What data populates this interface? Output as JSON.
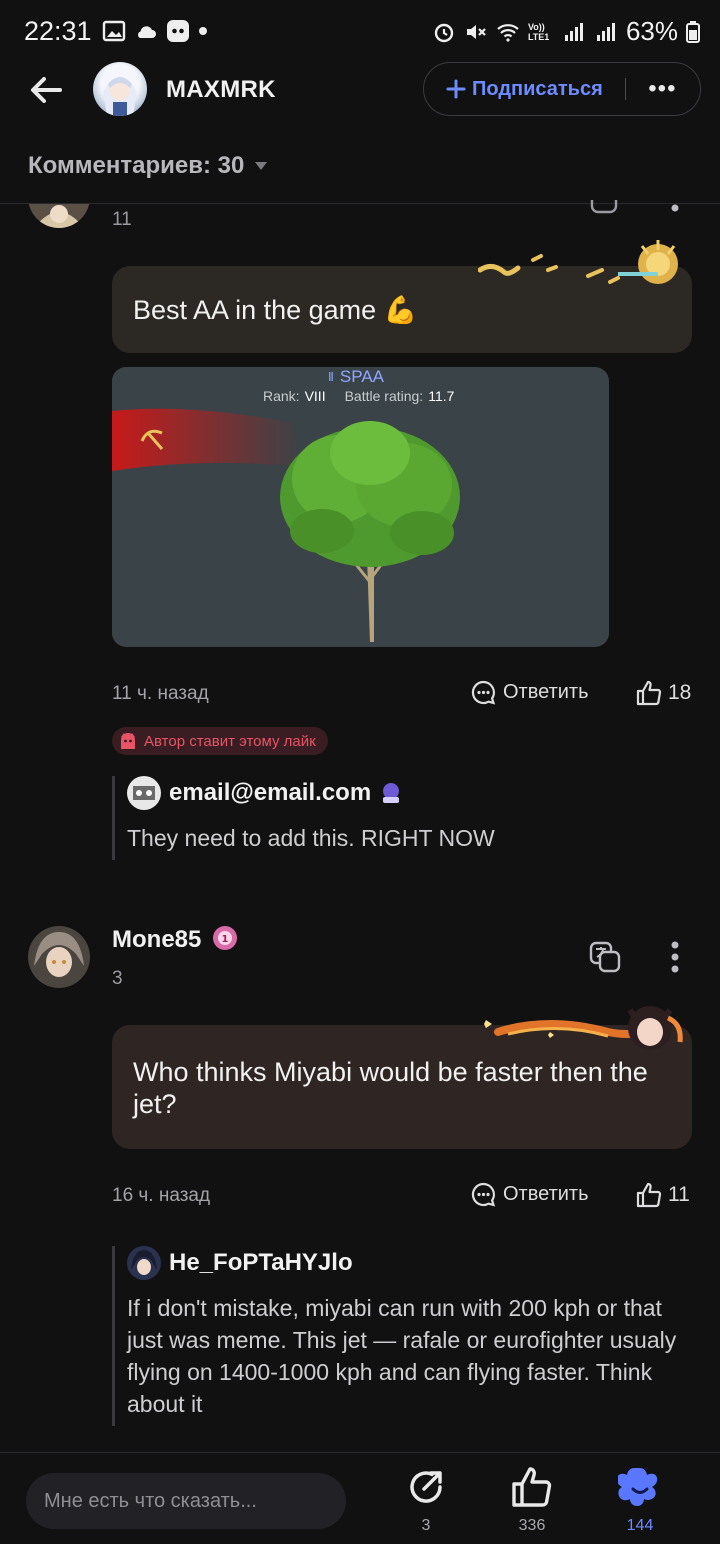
{
  "status_bar": {
    "time": "22:31",
    "battery": "63%",
    "volte": "Vo)) LTE1"
  },
  "header": {
    "title": "MAXMRK",
    "subscribe": "Подписаться",
    "more": "•••"
  },
  "comments": {
    "label": "Комментариев: 30"
  },
  "comment1": {
    "level": "11",
    "text": "Best AA in the game 💪",
    "image": {
      "category": "SPAA",
      "rank_label": "Rank:",
      "rank_value": "VIII",
      "br_label": "Battle rating:",
      "br_value": "11.7"
    },
    "time": "11 ч. назад",
    "reply": "Ответить",
    "likes": "18",
    "author_like": "Автор ставит этому лайк",
    "sub_reply": {
      "name": "email@email.com",
      "text": "They need to add this. RIGHT NOW"
    }
  },
  "comment2": {
    "name": "Mone85",
    "level": "3",
    "text": "Who thinks Miyabi would be faster then the jet?",
    "time": "16 ч. назад",
    "reply": "Ответить",
    "likes": "11",
    "sub_reply": {
      "name": "He_FoPTaHYJlo",
      "text": "If i don't mistake, miyabi can run with 200 kph or that just was meme. This jet — rafale or eurofighter usualy flying on 1400-1000 kph and can flying faster. Think about it"
    }
  },
  "bottom": {
    "placeholder": "Мне есть что сказать...",
    "shares": "3",
    "likes": "336",
    "reactions": "144"
  },
  "colors": {
    "accent": "#6d8cff",
    "bubble1": "#2c2924",
    "bubble2": "#2f2624",
    "author_like": "#e65466"
  }
}
